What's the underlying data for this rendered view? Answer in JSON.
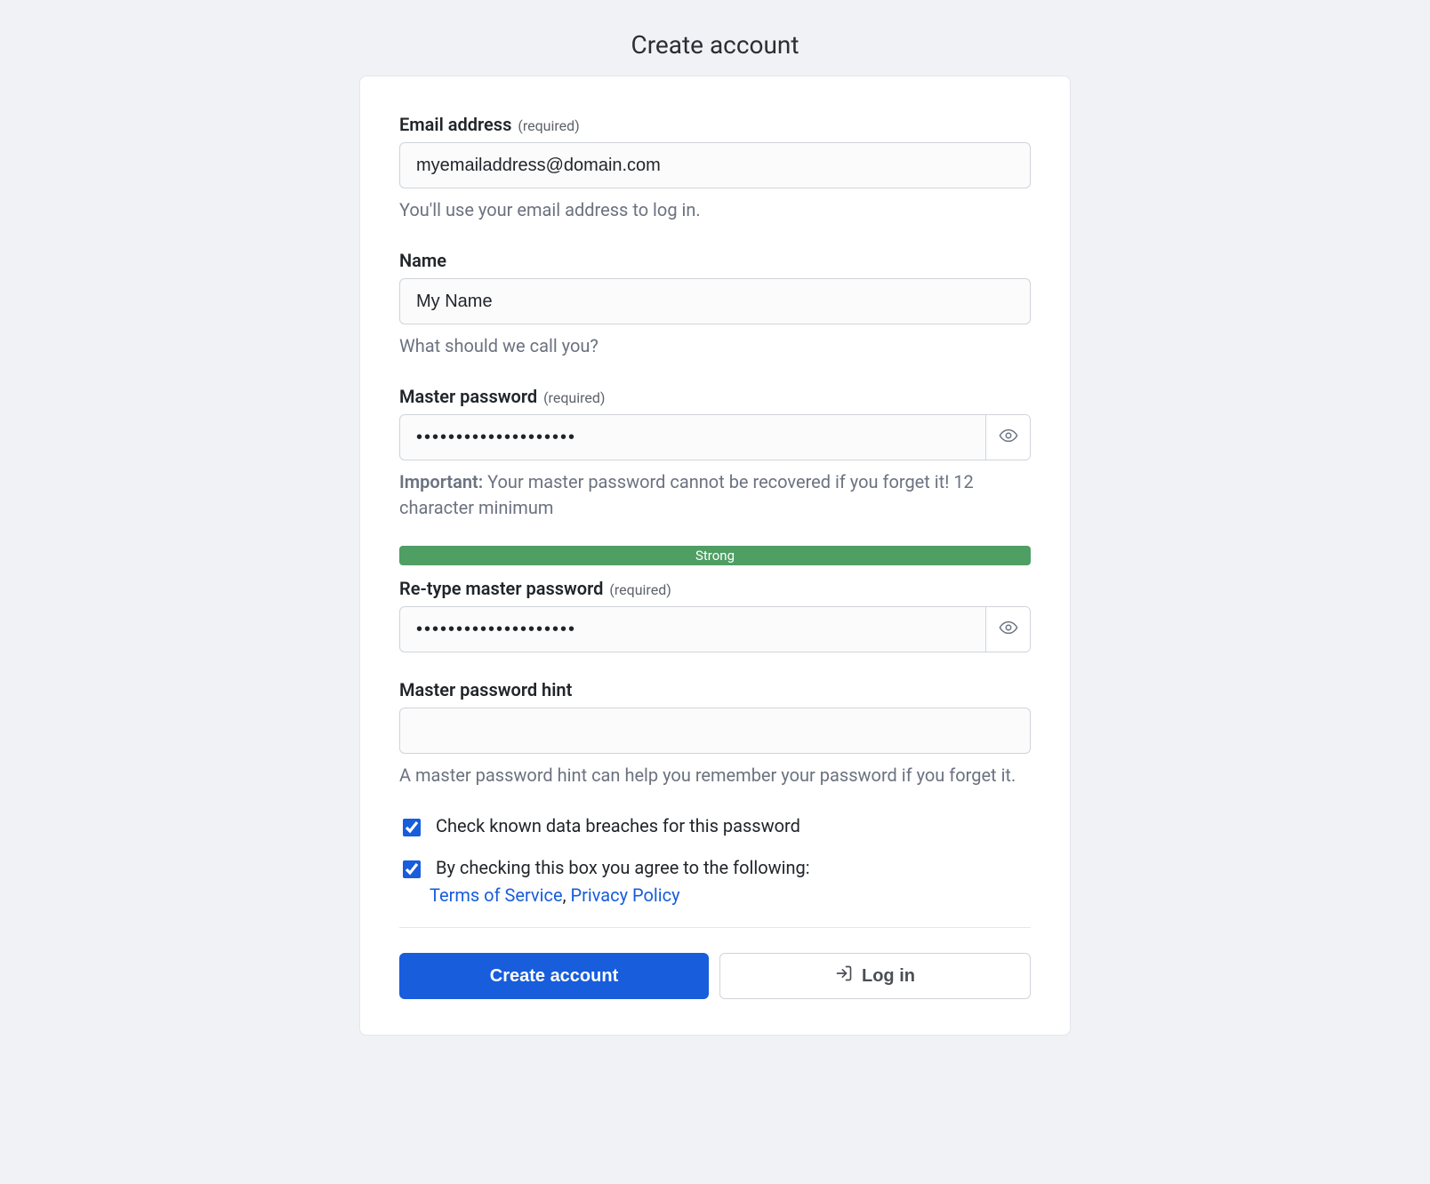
{
  "page": {
    "title": "Create account"
  },
  "fields": {
    "email": {
      "label": "Email address",
      "required_text": "(required)",
      "value": "myemailaddress@domain.com",
      "help": "You'll use your email address to log in."
    },
    "name": {
      "label": "Name",
      "value": "My Name",
      "help": "What should we call you?"
    },
    "password": {
      "label": "Master password",
      "required_text": "(required)",
      "value": "••••••••••••••••••••",
      "important_label": "Important:",
      "important_text": " Your master password cannot be recovered if you forget it! 12 character minimum"
    },
    "strength": {
      "label": "Strong"
    },
    "retype": {
      "label": "Re-type master password",
      "required_text": "(required)",
      "value": "••••••••••••••••••••"
    },
    "hint": {
      "label": "Master password hint",
      "value": "",
      "help": "A master password hint can help you remember your password if you forget it."
    }
  },
  "checks": {
    "breach": {
      "label": "Check known data breaches for this password",
      "checked": true
    },
    "tos": {
      "label": "By checking this box you agree to the following:",
      "checked": true,
      "terms_label": "Terms of Service",
      "sep": ", ",
      "privacy_label": "Privacy Policy"
    }
  },
  "buttons": {
    "create": "Create account",
    "login": "Log in"
  }
}
